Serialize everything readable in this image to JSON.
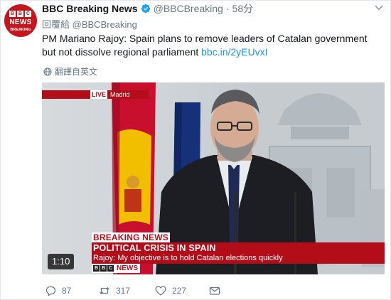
{
  "tweet": {
    "display_name": "BBC Breaking News",
    "handle": "@BBCBreaking",
    "separator": "·",
    "time": "58分",
    "reply_prefix": "回覆給",
    "reply_handle": "@BBCBreaking",
    "text": "PM Mariano Rajoy: Spain plans to remove leaders of Catalan government but not dissolve regional parliament",
    "link": "bbc.in/2yEUvxI",
    "translate_label": "翻譯自英文",
    "avatar": {
      "line1": [
        "B",
        "B",
        "C"
      ],
      "line2": "NEWS",
      "line3": "BREAKING"
    }
  },
  "media": {
    "live_label": "LIVE",
    "location": "Madrid",
    "breaking_label": "BREAKING NEWS",
    "headline": "POLITICAL CRISIS IN SPAIN",
    "subtitle": "Rajoy: My objective is to hold Catalan elections quickly",
    "brand_letters": [
      "B",
      "B",
      "C"
    ],
    "brand_word": "NEWS",
    "duration": "1:10"
  },
  "actions": {
    "replies": "87",
    "retweets": "317",
    "likes": "227"
  },
  "colors": {
    "bbc_red": "#b40d1a",
    "link_blue": "#1b95e0",
    "muted_gray": "#657786",
    "verified_blue": "#1da1f2"
  },
  "icons": [
    "verified-icon",
    "chevron-down-icon",
    "globe-icon",
    "reply-icon",
    "retweet-icon",
    "like-icon",
    "message-icon"
  ]
}
